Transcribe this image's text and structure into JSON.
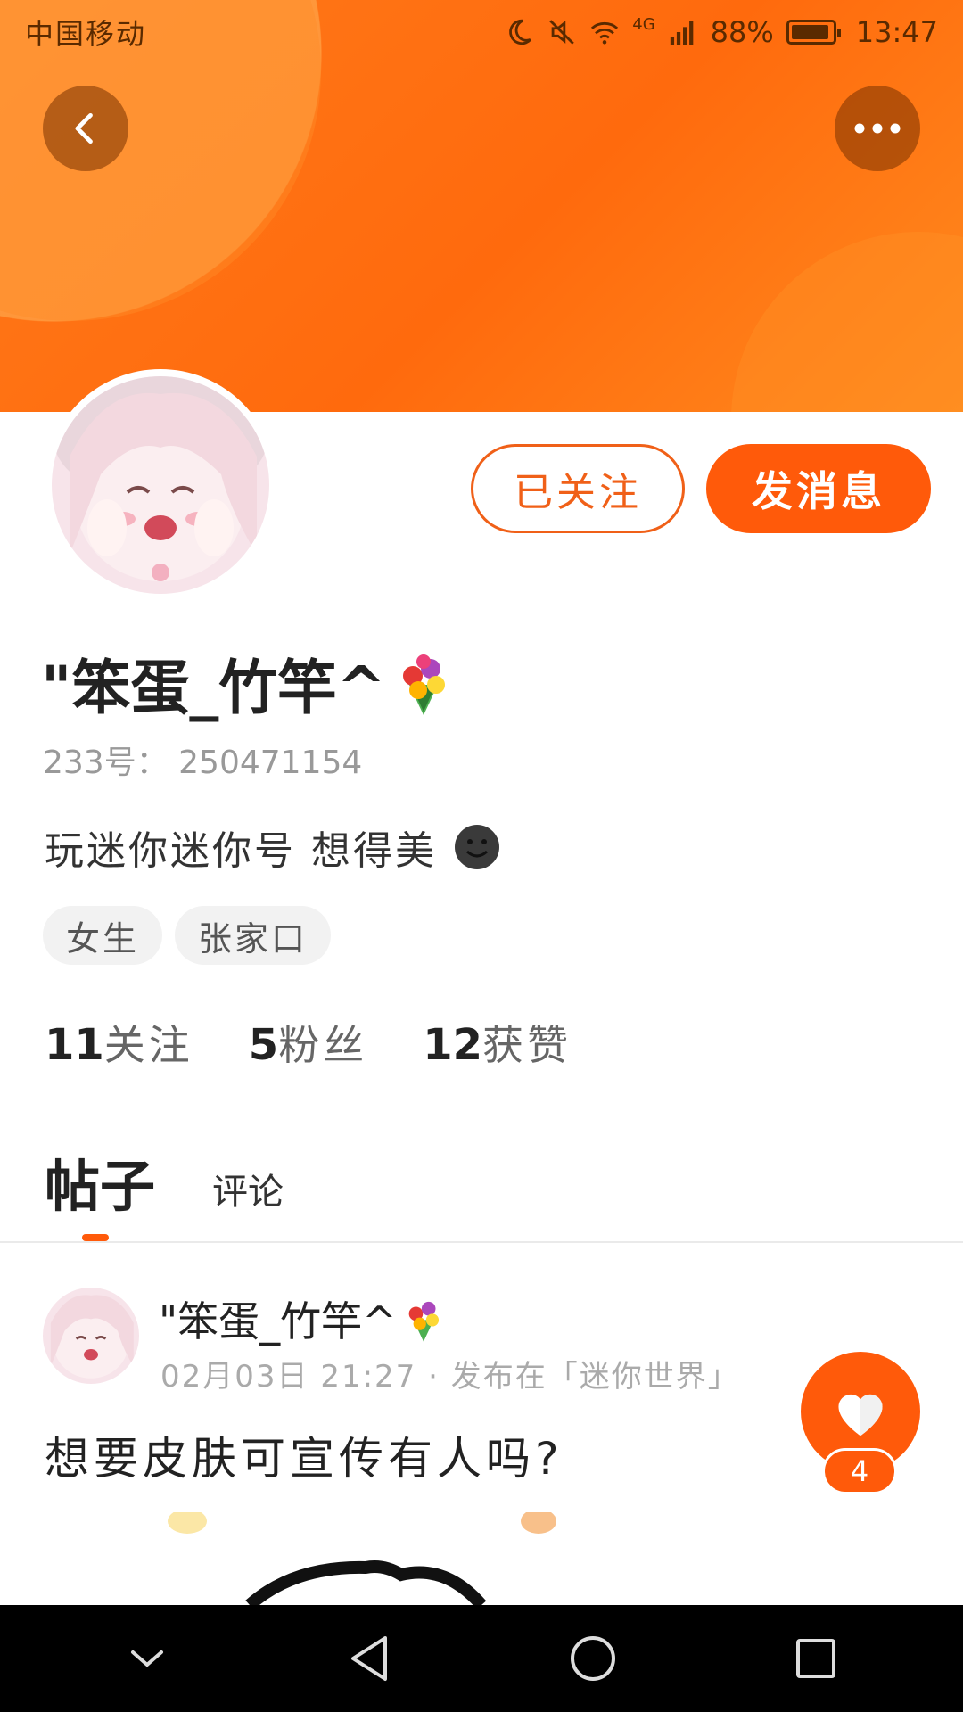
{
  "status_bar": {
    "carrier": "中国移动",
    "network": "4G",
    "battery": "88%",
    "time": "13:47"
  },
  "profile": {
    "name": "\"笨蛋_竹竿^",
    "uid": "233号： 250471154",
    "bio": "玩迷你迷你号 想得美",
    "tags": [
      "女生",
      "张家口"
    ],
    "stats": [
      {
        "num": "11",
        "label": "关注"
      },
      {
        "num": "5",
        "label": "粉丝"
      },
      {
        "num": "12",
        "label": "获赞"
      }
    ],
    "followed_label": "已关注",
    "message_label": "发消息"
  },
  "tabs": {
    "posts": "帖子",
    "comments": "评论"
  },
  "post": {
    "author": "\"笨蛋_竹竿^",
    "meta": "02月03日 21:27 · 发布在「迷你世界」",
    "text": "想要皮肤可宣传有人吗?",
    "likes": "4"
  },
  "colors": {
    "accent": "#ff5a0a",
    "header": "#ff7a1a"
  },
  "icons": [
    "back-icon",
    "more-icon",
    "moon-icon",
    "mute-icon",
    "wifi-icon",
    "signal-icon",
    "battery-icon",
    "bouquet-icon",
    "smiley-icon",
    "heart-icon",
    "nav-back-icon",
    "nav-home-icon",
    "nav-recents-icon",
    "nav-collapse-icon"
  ]
}
